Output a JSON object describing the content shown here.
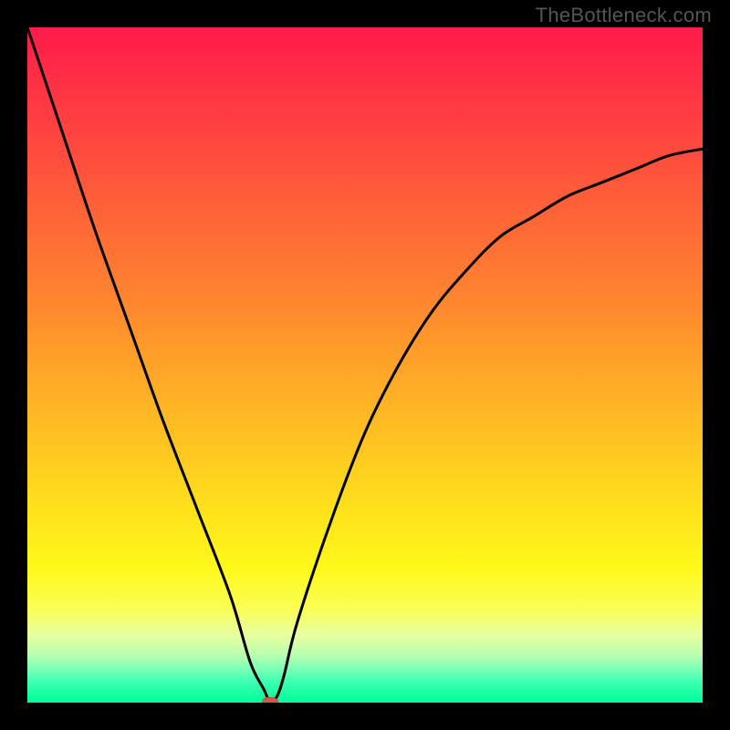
{
  "watermark": "TheBottleneck.com",
  "colors": {
    "frame": "#000000",
    "curve": "#000000",
    "marker": "#cf5a4a"
  },
  "chart_data": {
    "type": "line",
    "title": "",
    "xlabel": "",
    "ylabel": "",
    "xlim": [
      0,
      100
    ],
    "ylim": [
      0,
      100
    ],
    "grid": false,
    "legend": false,
    "background": "rainbow-gradient (red top → green bottom)",
    "series": [
      {
        "name": "bottleneck-curve",
        "x": [
          0,
          5,
          10,
          15,
          20,
          25,
          30,
          33,
          35,
          36,
          37,
          38,
          40,
          45,
          50,
          55,
          60,
          65,
          70,
          75,
          80,
          85,
          90,
          95,
          100
        ],
        "values": [
          100,
          85,
          70,
          56,
          42,
          29,
          16,
          6,
          2,
          0,
          1,
          4,
          12,
          27,
          40,
          50,
          58,
          64,
          69,
          72,
          75,
          77,
          79,
          81,
          82
        ]
      }
    ],
    "marker": {
      "x": 36,
      "y": 0
    }
  }
}
